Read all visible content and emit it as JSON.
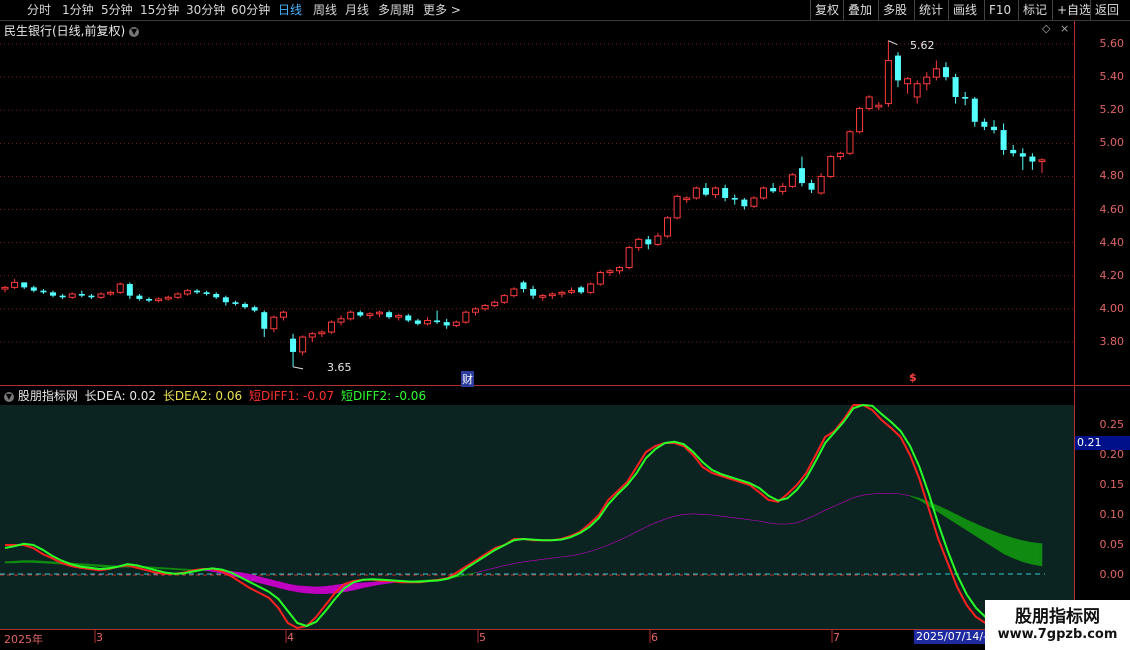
{
  "toolbar": {
    "periods": [
      "分时",
      "1分钟",
      "5分钟",
      "15分钟",
      "30分钟",
      "60分钟",
      "日线",
      "周线",
      "月线",
      "多周期",
      "更多 >"
    ],
    "active_period": "日线",
    "right_buttons": [
      "复权",
      "叠加",
      "多股",
      "统计",
      "画线",
      "F10",
      "标记",
      "+自选",
      "返回"
    ]
  },
  "main_pane": {
    "title": "民生银行(日线,前复权)",
    "high_label": "5.62",
    "low_label": "3.65",
    "marker_cai": "财",
    "marker_dollar": "$",
    "price_axis": [
      "5.60",
      "5.40",
      "5.20",
      "5.00",
      "4.80",
      "4.60",
      "4.40",
      "4.20",
      "4.00",
      "3.80"
    ]
  },
  "indicator_pane": {
    "name": "股朋指标网",
    "dea_label": "长DEA: 0.02",
    "dea2_label": "长DEA2: 0.06",
    "diff1_label": "短DIFF1: -0.07",
    "diff2_label": "短DIFF2: -0.06",
    "axis": [
      "0.25",
      "0.20",
      "0.15",
      "0.10",
      "0.05",
      "0.00"
    ],
    "current_value": "0.21"
  },
  "x_axis": {
    "labels": [
      "2025年",
      "3",
      "4",
      "5",
      "6",
      "7"
    ],
    "date_tag": "2025/07/14/-"
  },
  "watermark": {
    "main": "股朋指标网",
    "url": "www.7gpzb.com"
  },
  "colors": {
    "up": "#ff3b3b",
    "down": "#54ffff",
    "diff_red": "#ff2020",
    "diff_green": "#29ff29",
    "band_purple": "#c000c0",
    "band_green": "#108a10",
    "axis": "#e06666",
    "active": "#46b4ff"
  },
  "chart_data": {
    "type": "candlestick",
    "candles": [
      [
        4.12,
        4.14,
        4.1,
        4.13
      ],
      [
        4.13,
        4.18,
        4.12,
        4.16
      ],
      [
        4.16,
        4.16,
        4.12,
        4.13
      ],
      [
        4.13,
        4.14,
        4.1,
        4.11
      ],
      [
        4.11,
        4.12,
        4.09,
        4.1
      ],
      [
        4.1,
        4.11,
        4.07,
        4.08
      ],
      [
        4.08,
        4.09,
        4.06,
        4.07
      ],
      [
        4.07,
        4.1,
        4.06,
        4.09
      ],
      [
        4.09,
        4.11,
        4.07,
        4.08
      ],
      [
        4.08,
        4.09,
        4.06,
        4.07
      ],
      [
        4.07,
        4.1,
        4.06,
        4.09
      ],
      [
        4.09,
        4.11,
        4.08,
        4.1
      ],
      [
        4.1,
        4.16,
        4.09,
        4.15
      ],
      [
        4.15,
        4.16,
        4.06,
        4.08
      ],
      [
        4.08,
        4.09,
        4.05,
        4.06
      ],
      [
        4.06,
        4.07,
        4.04,
        4.05
      ],
      [
        4.05,
        4.07,
        4.04,
        4.06
      ],
      [
        4.06,
        4.08,
        4.05,
        4.07
      ],
      [
        4.07,
        4.1,
        4.06,
        4.09
      ],
      [
        4.09,
        4.12,
        4.08,
        4.11
      ],
      [
        4.11,
        4.12,
        4.09,
        4.1
      ],
      [
        4.1,
        4.11,
        4.08,
        4.09
      ],
      [
        4.09,
        4.1,
        4.06,
        4.07
      ],
      [
        4.07,
        4.08,
        4.02,
        4.04
      ],
      [
        4.04,
        4.05,
        4.02,
        4.03
      ],
      [
        4.03,
        4.04,
        4.0,
        4.01
      ],
      [
        4.01,
        4.02,
        3.98,
        3.99
      ],
      [
        3.98,
        3.99,
        3.83,
        3.88
      ],
      [
        3.88,
        3.96,
        3.86,
        3.95
      ],
      [
        3.95,
        3.99,
        3.93,
        3.98
      ],
      [
        3.82,
        3.85,
        3.65,
        3.74
      ],
      [
        3.74,
        3.84,
        3.72,
        3.83
      ],
      [
        3.83,
        3.86,
        3.8,
        3.85
      ],
      [
        3.85,
        3.87,
        3.83,
        3.86
      ],
      [
        3.86,
        3.93,
        3.85,
        3.92
      ],
      [
        3.92,
        3.96,
        3.9,
        3.94
      ],
      [
        3.94,
        3.99,
        3.93,
        3.98
      ],
      [
        3.98,
        3.99,
        3.95,
        3.96
      ],
      [
        3.96,
        3.98,
        3.94,
        3.97
      ],
      [
        3.97,
        3.99,
        3.95,
        3.98
      ],
      [
        3.98,
        3.99,
        3.94,
        3.95
      ],
      [
        3.95,
        3.97,
        3.93,
        3.96
      ],
      [
        3.96,
        3.97,
        3.92,
        3.93
      ],
      [
        3.93,
        3.94,
        3.9,
        3.91
      ],
      [
        3.91,
        3.95,
        3.9,
        3.93
      ],
      [
        3.93,
        3.99,
        3.91,
        3.92
      ],
      [
        3.92,
        3.94,
        3.88,
        3.9
      ],
      [
        3.9,
        3.93,
        3.89,
        3.92
      ],
      [
        3.92,
        3.99,
        3.91,
        3.98
      ],
      [
        3.98,
        4.01,
        3.96,
        4.0
      ],
      [
        4.0,
        4.03,
        3.99,
        4.02
      ],
      [
        4.02,
        4.05,
        4.01,
        4.04
      ],
      [
        4.04,
        4.09,
        4.03,
        4.08
      ],
      [
        4.08,
        4.13,
        4.07,
        4.12
      ],
      [
        4.16,
        4.17,
        4.1,
        4.12
      ],
      [
        4.12,
        4.14,
        4.06,
        4.08
      ],
      [
        4.07,
        4.09,
        4.05,
        4.08
      ],
      [
        4.08,
        4.1,
        4.06,
        4.09
      ],
      [
        4.09,
        4.11,
        4.07,
        4.1
      ],
      [
        4.1,
        4.13,
        4.09,
        4.11
      ],
      [
        4.13,
        4.14,
        4.09,
        4.1
      ],
      [
        4.1,
        4.16,
        4.09,
        4.15
      ],
      [
        4.15,
        4.23,
        4.14,
        4.22
      ],
      [
        4.22,
        4.24,
        4.2,
        4.23
      ],
      [
        4.23,
        4.26,
        4.21,
        4.25
      ],
      [
        4.25,
        4.38,
        4.24,
        4.37
      ],
      [
        4.37,
        4.43,
        4.35,
        4.42
      ],
      [
        4.42,
        4.44,
        4.36,
        4.39
      ],
      [
        4.39,
        4.46,
        4.38,
        4.44
      ],
      [
        4.44,
        4.56,
        4.43,
        4.55
      ],
      [
        4.55,
        4.69,
        4.54,
        4.68
      ],
      [
        4.66,
        4.68,
        4.64,
        4.67
      ],
      [
        4.67,
        4.74,
        4.66,
        4.73
      ],
      [
        4.73,
        4.76,
        4.68,
        4.69
      ],
      [
        4.69,
        4.74,
        4.67,
        4.73
      ],
      [
        4.73,
        4.75,
        4.65,
        4.67
      ],
      [
        4.67,
        4.69,
        4.63,
        4.66
      ],
      [
        4.66,
        4.67,
        4.6,
        4.62
      ],
      [
        4.62,
        4.68,
        4.61,
        4.67
      ],
      [
        4.67,
        4.74,
        4.66,
        4.73
      ],
      [
        4.73,
        4.76,
        4.7,
        4.71
      ],
      [
        4.71,
        4.76,
        4.69,
        4.74
      ],
      [
        4.74,
        4.82,
        4.73,
        4.81
      ],
      [
        4.85,
        4.92,
        4.74,
        4.76
      ],
      [
        4.76,
        4.78,
        4.7,
        4.72
      ],
      [
        4.7,
        4.82,
        4.69,
        4.8
      ],
      [
        4.8,
        4.93,
        4.79,
        4.92
      ],
      [
        4.92,
        4.95,
        4.9,
        4.94
      ],
      [
        4.94,
        5.08,
        4.93,
        5.07
      ],
      [
        5.07,
        5.22,
        5.06,
        5.21
      ],
      [
        5.21,
        5.29,
        5.2,
        5.28
      ],
      [
        5.22,
        5.25,
        5.2,
        5.23
      ],
      [
        5.24,
        5.62,
        5.22,
        5.5
      ],
      [
        5.53,
        5.55,
        5.34,
        5.38
      ],
      [
        5.36,
        5.4,
        5.3,
        5.39
      ],
      [
        5.28,
        5.38,
        5.24,
        5.36
      ],
      [
        5.36,
        5.43,
        5.32,
        5.4
      ],
      [
        5.4,
        5.5,
        5.38,
        5.45
      ],
      [
        5.46,
        5.49,
        5.38,
        5.4
      ],
      [
        5.4,
        5.42,
        5.24,
        5.28
      ],
      [
        5.28,
        5.31,
        5.23,
        5.27
      ],
      [
        5.27,
        5.28,
        5.1,
        5.13
      ],
      [
        5.13,
        5.15,
        5.08,
        5.1
      ],
      [
        5.1,
        5.14,
        5.06,
        5.08
      ],
      [
        5.08,
        5.12,
        4.93,
        4.96
      ],
      [
        4.96,
        4.99,
        4.92,
        4.94
      ],
      [
        4.94,
        4.97,
        4.84,
        4.92
      ],
      [
        4.92,
        4.94,
        4.84,
        4.89
      ],
      [
        4.89,
        4.91,
        4.82,
        4.9
      ]
    ],
    "price_range": [
      3.65,
      5.62
    ],
    "indicator": {
      "diff1": [
        0.05,
        0.05,
        0.05,
        0.045,
        0.035,
        0.028,
        0.02,
        0.015,
        0.012,
        0.01,
        0.008,
        0.01,
        0.014,
        0.016,
        0.012,
        0.008,
        0.004,
        0.002,
        0.002,
        0.004,
        0.008,
        0.01,
        0.01,
        0.006,
        -0.002,
        -0.012,
        -0.022,
        -0.03,
        -0.038,
        -0.055,
        -0.08,
        -0.09,
        -0.085,
        -0.07,
        -0.05,
        -0.03,
        -0.015,
        -0.01,
        -0.008,
        -0.008,
        -0.01,
        -0.01,
        -0.012,
        -0.012,
        -0.012,
        -0.01,
        -0.008,
        -0.005,
        0.005,
        0.015,
        0.025,
        0.035,
        0.045,
        0.05,
        0.06,
        0.06,
        0.058,
        0.058,
        0.058,
        0.06,
        0.065,
        0.072,
        0.085,
        0.1,
        0.125,
        0.14,
        0.155,
        0.18,
        0.205,
        0.215,
        0.22,
        0.22,
        0.215,
        0.2,
        0.18,
        0.17,
        0.165,
        0.16,
        0.155,
        0.15,
        0.138,
        0.125,
        0.122,
        0.135,
        0.15,
        0.17,
        0.2,
        0.23,
        0.24,
        0.26,
        0.285,
        0.285,
        0.275,
        0.258,
        0.245,
        0.23,
        0.2,
        0.16,
        0.11,
        0.06,
        0.02,
        -0.02,
        -0.05,
        -0.07,
        -0.08,
        -0.085,
        -0.085,
        -0.08,
        -0.075,
        -0.072,
        -0.07
      ],
      "diff2": [
        0.045,
        0.048,
        0.052,
        0.05,
        0.042,
        0.032,
        0.024,
        0.018,
        0.014,
        0.012,
        0.01,
        0.011,
        0.014,
        0.018,
        0.016,
        0.012,
        0.008,
        0.004,
        0.002,
        0.003,
        0.006,
        0.009,
        0.011,
        0.009,
        0.004,
        -0.004,
        -0.012,
        -0.02,
        -0.028,
        -0.04,
        -0.06,
        -0.08,
        -0.085,
        -0.078,
        -0.06,
        -0.04,
        -0.022,
        -0.012,
        -0.008,
        -0.007,
        -0.008,
        -0.009,
        -0.01,
        -0.011,
        -0.011,
        -0.01,
        -0.009,
        -0.006,
        0.0,
        0.012,
        0.022,
        0.032,
        0.042,
        0.05,
        0.058,
        0.06,
        0.059,
        0.058,
        0.058,
        0.059,
        0.063,
        0.07,
        0.08,
        0.095,
        0.118,
        0.135,
        0.15,
        0.17,
        0.195,
        0.21,
        0.22,
        0.222,
        0.218,
        0.205,
        0.188,
        0.175,
        0.168,
        0.163,
        0.158,
        0.153,
        0.145,
        0.132,
        0.124,
        0.128,
        0.142,
        0.162,
        0.19,
        0.22,
        0.238,
        0.256,
        0.278,
        0.288,
        0.282,
        0.268,
        0.255,
        0.24,
        0.215,
        0.18,
        0.135,
        0.085,
        0.04,
        0.0,
        -0.032,
        -0.055,
        -0.07,
        -0.078,
        -0.08,
        -0.078,
        -0.074,
        -0.068,
        -0.062
      ],
      "dea": [
        0.02,
        0.02,
        0.021,
        0.021,
        0.02,
        0.019,
        0.018,
        0.017,
        0.016,
        0.015,
        0.014,
        0.013,
        0.013,
        0.013,
        0.013,
        0.012,
        0.011,
        0.01,
        0.009,
        0.008,
        0.008,
        0.008,
        0.008,
        0.007,
        0.006,
        0.004,
        0.001,
        -0.003,
        -0.007,
        -0.011,
        -0.015,
        -0.018,
        -0.019,
        -0.02,
        -0.019,
        -0.017,
        -0.015,
        -0.014,
        -0.013,
        -0.012,
        -0.011,
        -0.01,
        -0.01,
        -0.01,
        -0.01,
        -0.009,
        -0.008,
        -0.006,
        -0.003,
        0.0,
        0.004,
        0.008,
        0.012,
        0.016,
        0.019,
        0.022,
        0.024,
        0.026,
        0.028,
        0.03,
        0.032,
        0.035,
        0.039,
        0.044,
        0.05,
        0.057,
        0.064,
        0.072,
        0.08,
        0.087,
        0.093,
        0.098,
        0.101,
        0.102,
        0.101,
        0.1,
        0.098,
        0.096,
        0.094,
        0.092,
        0.09,
        0.087,
        0.085,
        0.085,
        0.087,
        0.093,
        0.1,
        0.108,
        0.115,
        0.122,
        0.129,
        0.133,
        0.135,
        0.136,
        0.136,
        0.135,
        0.132,
        0.125,
        0.115,
        0.105,
        0.095,
        0.085,
        0.075,
        0.065,
        0.055,
        0.045,
        0.035,
        0.028,
        0.022,
        0.018,
        0.015
      ],
      "dea2": [
        0.022,
        0.023,
        0.024,
        0.024,
        0.023,
        0.022,
        0.021,
        0.02,
        0.019,
        0.018,
        0.017,
        0.016,
        0.015,
        0.015,
        0.014,
        0.014,
        0.013,
        0.012,
        0.011,
        0.01,
        0.009,
        0.008,
        0.006,
        0.003,
        -0.001,
        -0.005,
        -0.009,
        -0.013,
        -0.017,
        -0.021,
        -0.025,
        -0.028,
        -0.03,
        -0.031,
        -0.031,
        -0.03,
        -0.028,
        -0.025,
        -0.021,
        -0.018,
        -0.015,
        -0.013,
        -0.011,
        -0.01,
        -0.009,
        -0.008,
        -0.007,
        -0.005,
        -0.002,
        0.001,
        0.004,
        0.008,
        0.012,
        0.016,
        0.019,
        0.022,
        0.024,
        0.026,
        0.028,
        0.03,
        0.032,
        0.035,
        0.039,
        0.044,
        0.05,
        0.057,
        0.064,
        0.072,
        0.08,
        0.087,
        0.093,
        0.098,
        0.101,
        0.102,
        0.101,
        0.1,
        0.098,
        0.096,
        0.094,
        0.092,
        0.09,
        0.087,
        0.085,
        0.085,
        0.087,
        0.093,
        0.1,
        0.108,
        0.115,
        0.122,
        0.129,
        0.133,
        0.135,
        0.136,
        0.136,
        0.135,
        0.132,
        0.128,
        0.122,
        0.115,
        0.108,
        0.1,
        0.092,
        0.085,
        0.078,
        0.072,
        0.066,
        0.061,
        0.057,
        0.054,
        0.052
      ],
      "ylim": [
        -0.09,
        0.29
      ]
    }
  }
}
